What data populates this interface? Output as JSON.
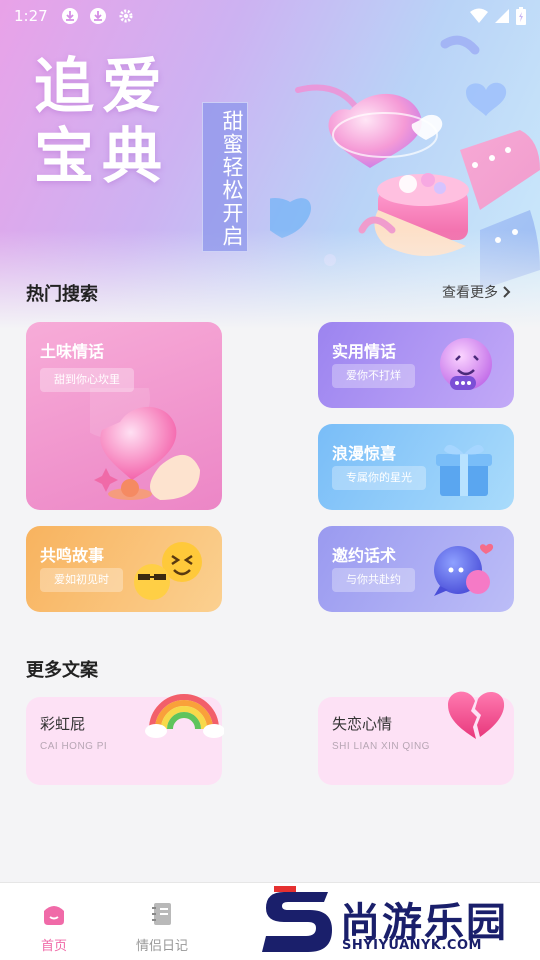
{
  "status_bar": {
    "time": "1:27",
    "icons": [
      "download-icon",
      "download-icon",
      "gear-icon"
    ],
    "right_icons": [
      "wifi-icon",
      "signal-icon",
      "battery-icon"
    ]
  },
  "hero": {
    "title_line1": "追爱",
    "title_line2": "宝典",
    "subtitle": "甜蜜轻松开启"
  },
  "hot_search": {
    "title": "热门搜索",
    "see_more": "查看更多",
    "cards": [
      {
        "title": "土味情话",
        "pill": "甜到你心坎里",
        "deco": "heart-hand-icon",
        "color_from": "#f6a7d6",
        "color_to": "#eb86c6"
      },
      {
        "title": "实用情话",
        "pill": "爱你不打烊",
        "deco": "chat-bubble-emoji-icon",
        "color_from": "#a48cf2",
        "color_to": "#c0a6f6"
      },
      {
        "title": "浪漫惊喜",
        "pill": "专属你的星光",
        "deco": "gift-box-icon",
        "color_from": "#7cc0f8",
        "color_to": "#a8dafb"
      },
      {
        "title": "共鸣故事",
        "pill": "爱如初见时",
        "deco": "emoji-faces-icon",
        "color_from": "#f9b96c",
        "color_to": "#fbcf84"
      },
      {
        "title": "邀约话术",
        "pill": "与你共赴约",
        "deco": "chat-bubbles-icon",
        "color_from": "#9b9cf0",
        "color_to": "#b8b8f6"
      }
    ]
  },
  "more_copy": {
    "title": "更多文案",
    "items": [
      {
        "title": "彩虹屁",
        "subtitle": "CAI HONG PI",
        "deco": "rainbow-icon"
      },
      {
        "title": "失恋心情",
        "subtitle": "SHI LIAN XIN QING",
        "deco": "broken-heart-icon"
      }
    ]
  },
  "tabbar": {
    "items": [
      {
        "label": "首页",
        "icon": "home-icon",
        "active": true,
        "color": "#f06aa8"
      },
      {
        "label": "情侣日记",
        "icon": "notebook-icon",
        "active": false,
        "color": "#999999"
      }
    ]
  },
  "watermark": {
    "text": "尚游乐园",
    "url": "SHYIYUANYK.COM"
  }
}
